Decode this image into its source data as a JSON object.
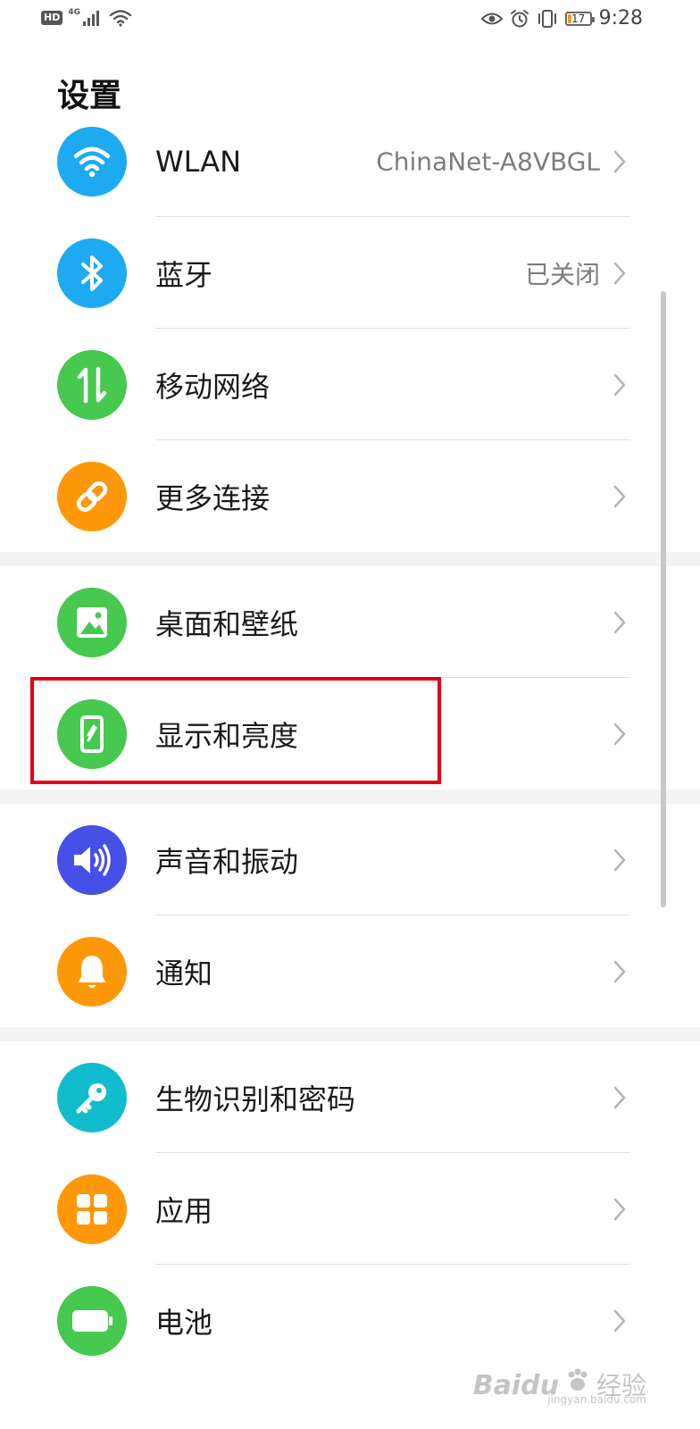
{
  "status_bar": {
    "hd": "HD",
    "network": "4G",
    "battery": "17",
    "battery_level_pct": 17,
    "time": "9:28"
  },
  "title": "设置",
  "colors": {
    "blue": "#1eaaf1",
    "green": "#47c84f",
    "orange": "#fd9809",
    "indigo": "#4750e6",
    "teal": "#11bdcc",
    "highlight": "#e60012"
  },
  "groups": [
    [
      {
        "icon": "wifi-icon",
        "color": "#1eaaf1",
        "label": "WLAN",
        "value": "ChinaNet-A8VBGL"
      },
      {
        "icon": "bluetooth-icon",
        "color": "#1eaaf1",
        "label": "蓝牙",
        "value": "已关闭"
      },
      {
        "icon": "mobile-data-icon",
        "color": "#47c84f",
        "label": "移动网络",
        "value": ""
      },
      {
        "icon": "link-icon",
        "color": "#fd9809",
        "label": "更多连接",
        "value": ""
      }
    ],
    [
      {
        "icon": "wallpaper-icon",
        "color": "#47c84f",
        "label": "桌面和壁纸",
        "value": ""
      },
      {
        "icon": "display-icon",
        "color": "#47c84f",
        "label": "显示和亮度",
        "value": ""
      }
    ],
    [
      {
        "icon": "sound-icon",
        "color": "#4750e6",
        "label": "声音和振动",
        "value": ""
      },
      {
        "icon": "bell-icon",
        "color": "#fd9809",
        "label": "通知",
        "value": ""
      }
    ],
    [
      {
        "icon": "key-icon",
        "color": "#11bdcc",
        "label": "生物识别和密码",
        "value": ""
      },
      {
        "icon": "apps-icon",
        "color": "#fd9809",
        "label": "应用",
        "value": ""
      },
      {
        "icon": "battery-icon",
        "color": "#47c84f",
        "label": "电池",
        "value": ""
      }
    ]
  ],
  "watermark": {
    "brand": "Baidu",
    "cn": "经验",
    "url": "jingyan.baidu.com"
  }
}
